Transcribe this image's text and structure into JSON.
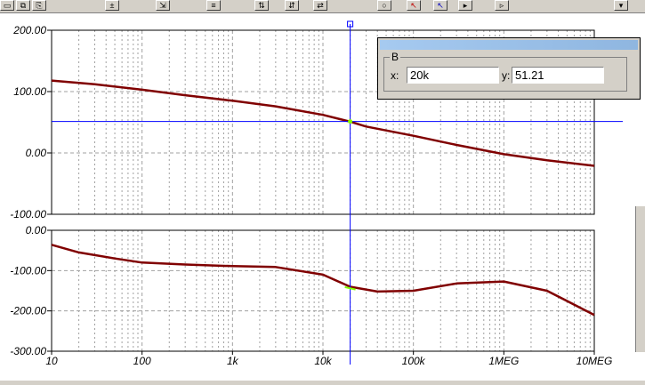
{
  "toolbar": {
    "buttons": [
      {
        "icon": "window-icon",
        "glyph": "▭"
      },
      {
        "icon": "copy-icon",
        "glyph": "⧉"
      },
      {
        "icon": "paste-icon",
        "glyph": "⎘"
      },
      {
        "icon": "zoom-icon",
        "glyph": "±"
      },
      {
        "icon": "zoom-100-icon",
        "glyph": "⇲"
      },
      {
        "icon": "grid-icon",
        "glyph": "≡"
      },
      {
        "icon": "axis-y1-icon",
        "glyph": "⇅"
      },
      {
        "icon": "axis-y2-icon",
        "glyph": "⇵"
      },
      {
        "icon": "axis-x-icon",
        "glyph": "⇄"
      },
      {
        "icon": "circle-icon",
        "glyph": "○"
      },
      {
        "icon": "cursor-a-icon",
        "glyph": "↖"
      },
      {
        "icon": "cursor-b-icon",
        "glyph": "↖"
      },
      {
        "icon": "play-icon",
        "glyph": "▸"
      },
      {
        "icon": "next-icon",
        "glyph": "▹"
      },
      {
        "icon": "chevron-down-icon",
        "glyph": "▾"
      }
    ]
  },
  "cursor_panel": {
    "legend": "B",
    "x_label": "x:",
    "x_value": "20k",
    "y_label": "y:",
    "y_value": "51.21"
  },
  "colors": {
    "plot_bg": "#ffffff",
    "trace": "#800000",
    "cursor": "#0000ff",
    "grid": "#a0a0a0",
    "cursor_marker": "#80ff00"
  },
  "chart_data": [
    {
      "type": "line",
      "x_scale": "log",
      "xlim": [
        10,
        10000000
      ],
      "ylim": [
        -100,
        200
      ],
      "y_ticks": [
        200,
        100,
        0,
        -100
      ],
      "y_tick_labels": [
        "200.00",
        "100.00",
        "0.00",
        "-100.00"
      ],
      "grid": true,
      "series": [
        {
          "x": [
            10,
            30,
            100,
            300,
            1000,
            3000,
            10000,
            20000,
            30000,
            100000,
            300000,
            1000000,
            3000000,
            10000000
          ],
          "values": [
            118,
            112,
            103,
            94,
            85,
            76,
            62,
            51,
            43,
            28,
            13,
            -2,
            -12,
            -21
          ]
        }
      ]
    },
    {
      "type": "line",
      "x_scale": "log",
      "xlim": [
        10,
        10000000
      ],
      "ylim": [
        -300,
        0
      ],
      "y_ticks": [
        0,
        -100,
        -200,
        -300
      ],
      "y_tick_labels": [
        "0.00",
        "-100.00",
        "-200.00",
        "-300.00"
      ],
      "x_tick_labels": [
        "10",
        "100",
        "1k",
        "10k",
        "100k",
        "1MEG",
        "10MEG"
      ],
      "grid": true,
      "series": [
        {
          "x": [
            10,
            20,
            50,
            100,
            300,
            1000,
            3000,
            10000,
            20000,
            40000,
            100000,
            300000,
            1000000,
            3000000,
            10000000
          ],
          "values": [
            -36,
            -55,
            -70,
            -80,
            -85,
            -89,
            -91,
            -110,
            -140,
            -152,
            -150,
            -132,
            -127,
            -150,
            -210
          ]
        }
      ]
    }
  ],
  "cursor": {
    "x": 20000
  }
}
